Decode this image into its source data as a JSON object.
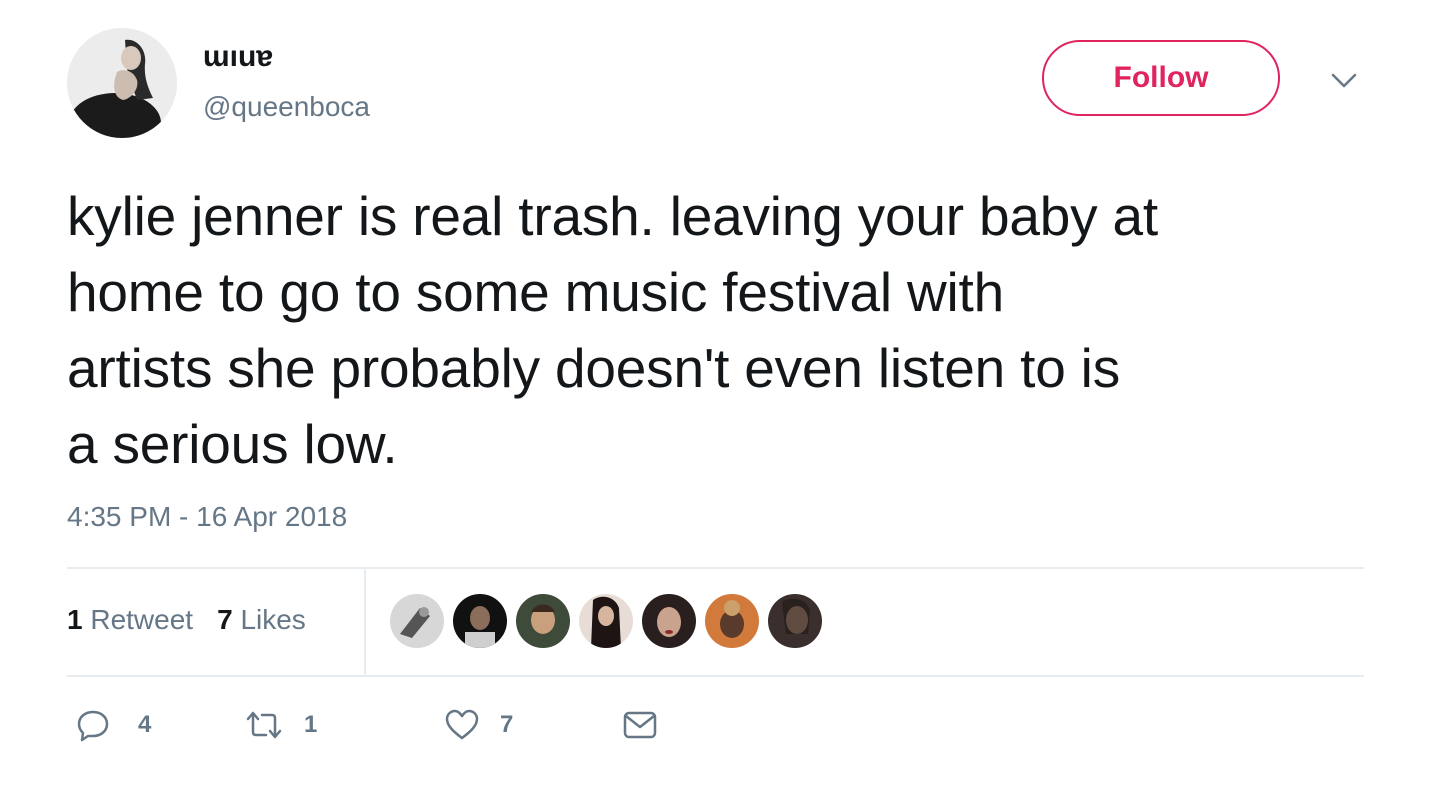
{
  "user": {
    "display_name": "ɯıuɐ",
    "handle": "@queenboca",
    "avatar_icon": "profile-photo"
  },
  "follow_label": "Follow",
  "caret_icon": "chevron-down-icon",
  "tweet_text": "kylie jenner is real trash. leaving your baby at\nhome to go to some music festival with\nartists she probably doesn't even listen to is\na serious low.",
  "timestamp": "4:35 PM - 16 Apr 2018",
  "stats": {
    "retweets_count": "1",
    "retweets_label": "Retweet",
    "likes_count": "7",
    "likes_label": "Likes"
  },
  "likers": [
    {
      "icon": "liker-avatar"
    },
    {
      "icon": "liker-avatar"
    },
    {
      "icon": "liker-avatar"
    },
    {
      "icon": "liker-avatar"
    },
    {
      "icon": "liker-avatar"
    },
    {
      "icon": "liker-avatar"
    },
    {
      "icon": "liker-avatar"
    }
  ],
  "actions": {
    "replies": "4",
    "retweets": "1",
    "likes": "7"
  },
  "colors": {
    "follow_accent": "#e0245e",
    "secondary_text": "#657786",
    "divider": "#e6ecf0"
  }
}
